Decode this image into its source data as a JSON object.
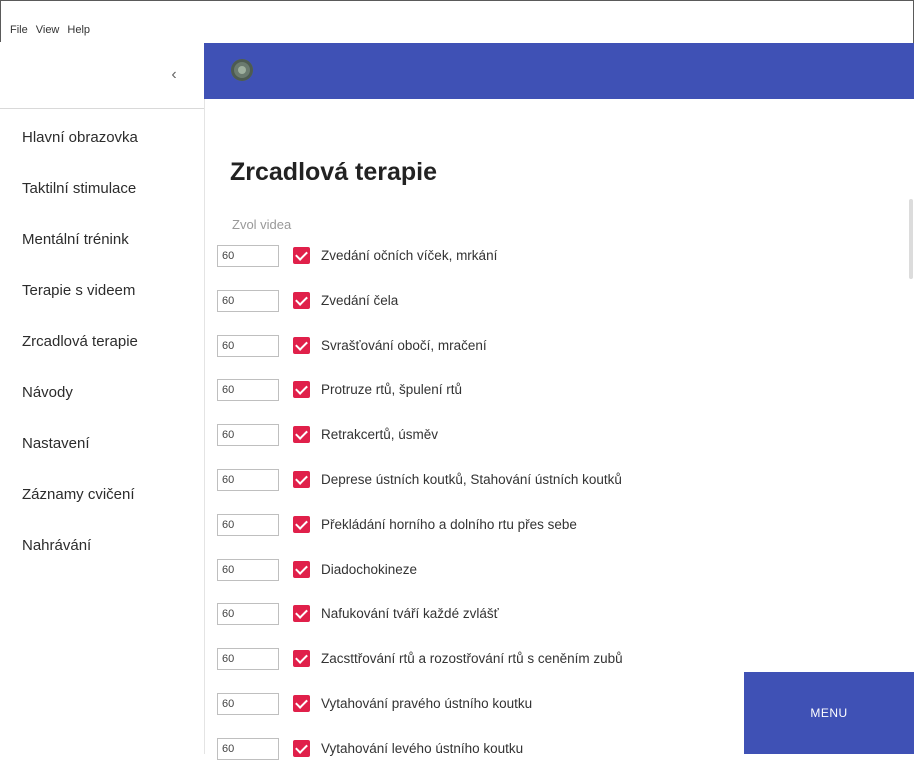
{
  "menubar": {
    "file": "File",
    "view": "View",
    "help": "Help"
  },
  "sidebar": {
    "collapse_glyph": "‹",
    "items": [
      {
        "label": "Hlavní obrazovka"
      },
      {
        "label": "Taktilní stimulace"
      },
      {
        "label": "Mentální trénink"
      },
      {
        "label": "Terapie s videem"
      },
      {
        "label": "Zrcadlová terapie"
      },
      {
        "label": "Návody"
      },
      {
        "label": "Nastavení"
      },
      {
        "label": "Záznamy cvičení"
      },
      {
        "label": "Nahrávání"
      }
    ]
  },
  "topbar": {
    "accent": "#3f51b5",
    "avatar_icon": "avatar-icon"
  },
  "main": {
    "title": "Zrcadlová terapie",
    "section_label": "Zvol videa",
    "exercises": [
      {
        "value": "60",
        "checked": true,
        "label": "Zvedání očních víček, mrkání"
      },
      {
        "value": "60",
        "checked": true,
        "label": "Zvedání čela"
      },
      {
        "value": "60",
        "checked": true,
        "label": "Svrašťování obočí, mračení"
      },
      {
        "value": "60",
        "checked": true,
        "label": "Protruze rtů, špulení rtů"
      },
      {
        "value": "60",
        "checked": true,
        "label": "Retrakcertů, úsměv"
      },
      {
        "value": "60",
        "checked": true,
        "label": "Deprese ústních koutků, Stahování ústních koutků"
      },
      {
        "value": "60",
        "checked": true,
        "label": "Překládání horního a dolního rtu přes sebe"
      },
      {
        "value": "60",
        "checked": true,
        "label": "Diadochokineze"
      },
      {
        "value": "60",
        "checked": true,
        "label": "Nafukování tváří každé zvlášť"
      },
      {
        "value": "60",
        "checked": true,
        "label": "Zacsttřování rtů a rozostřování rtů s ceněním zubů"
      },
      {
        "value": "60",
        "checked": true,
        "label": "Vytahování pravého ústního koutku"
      },
      {
        "value": "60",
        "checked": true,
        "label": "Vytahování levého ústního koutku"
      }
    ],
    "checkbox_color": "#e0204a"
  },
  "menu_button": {
    "label": "MENU"
  }
}
